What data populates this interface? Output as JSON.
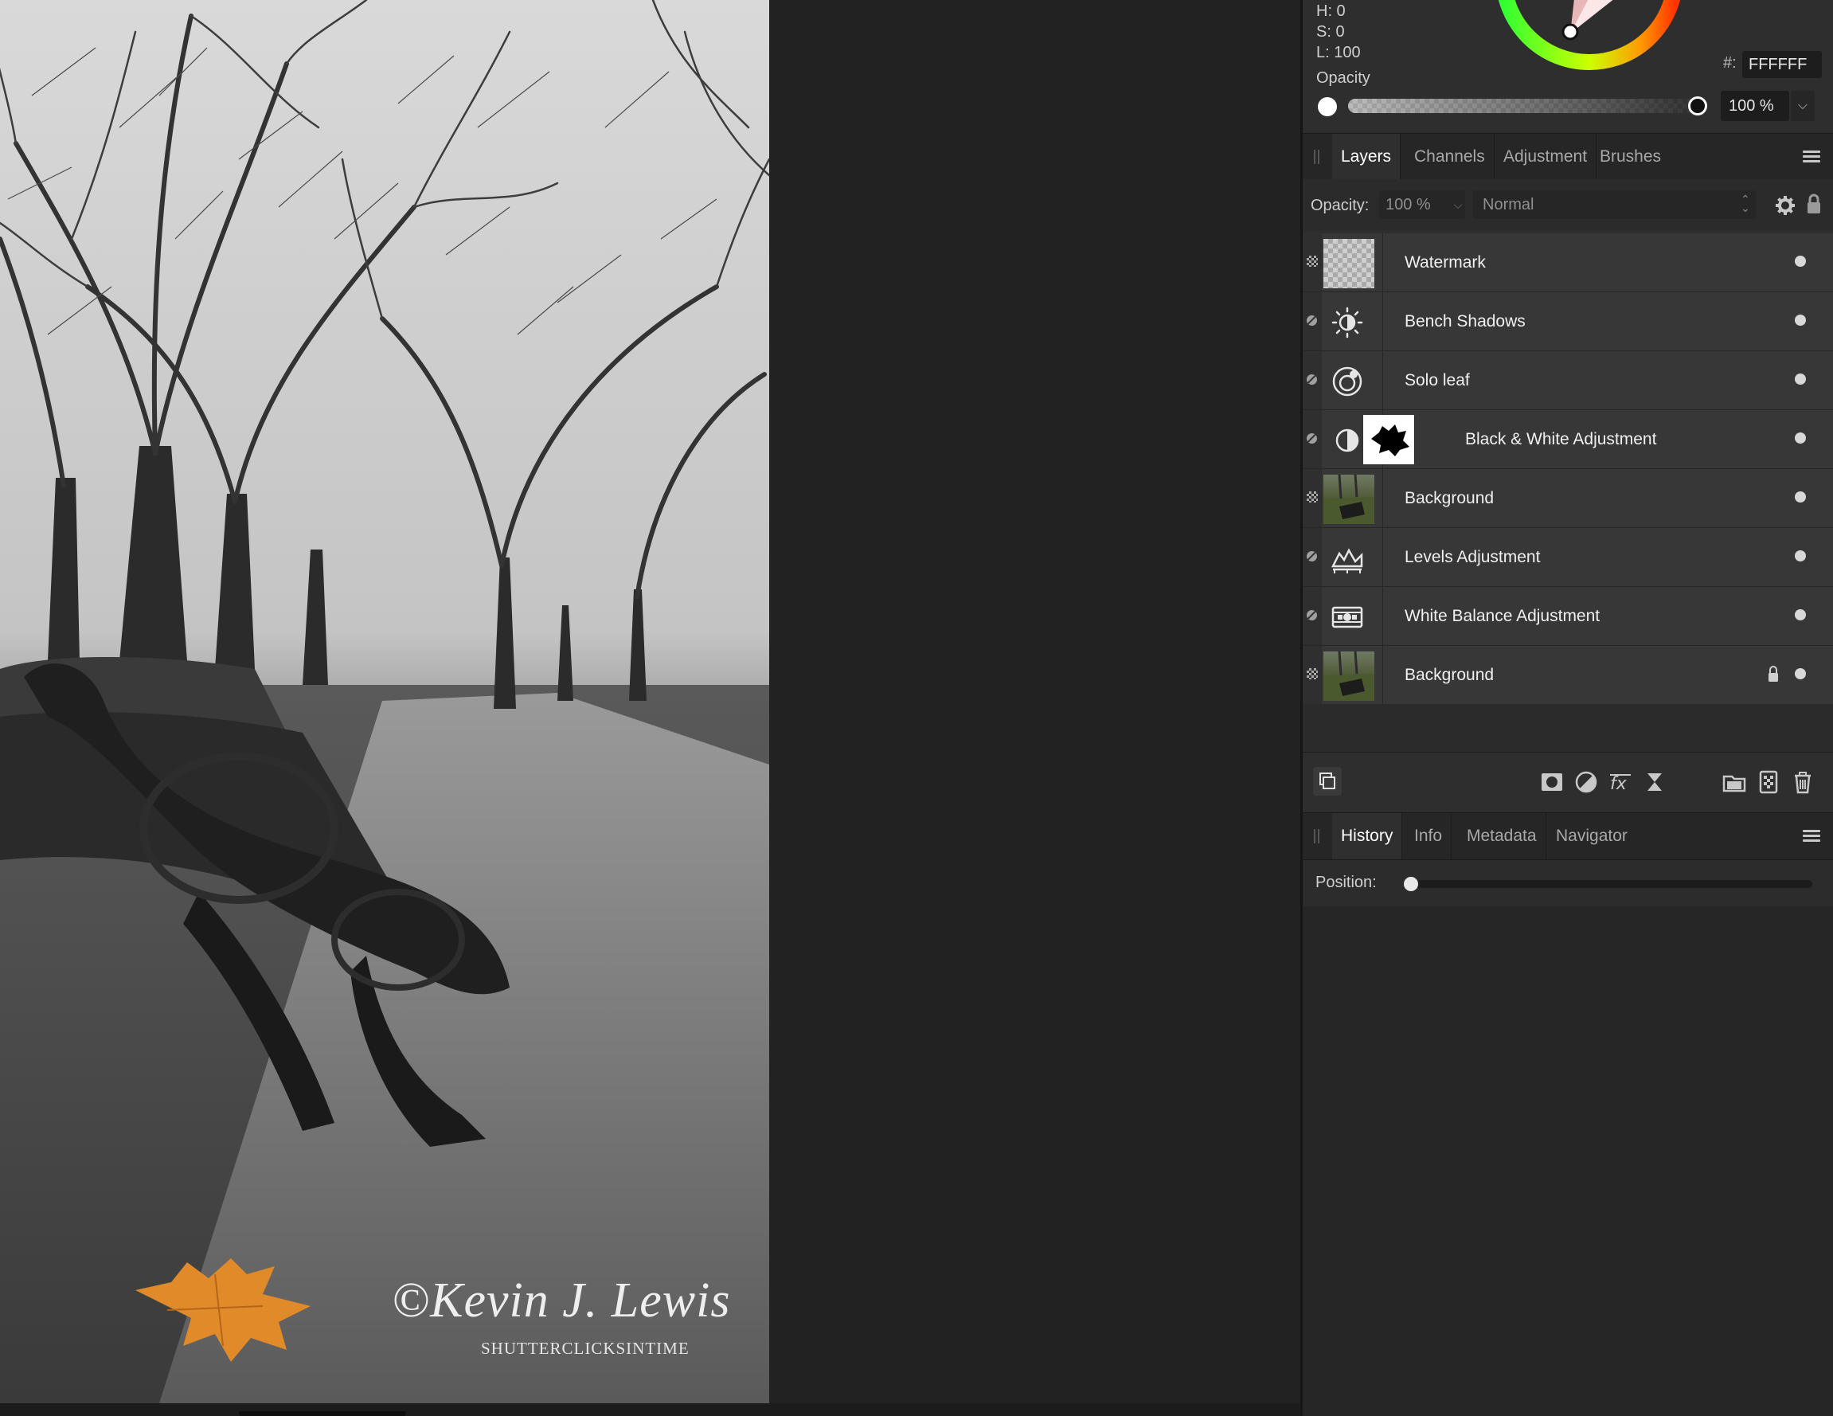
{
  "canvas": {
    "watermark_name": "©Kevin J. Lewis",
    "watermark_site": "SHUTTERCLICKSINTIME"
  },
  "color_panel": {
    "h_label": "H: 0",
    "s_label": "S: 0",
    "l_label": "L: 100",
    "hex_prefix": "#:",
    "hex_value": "FFFFFF",
    "opacity_label": "Opacity",
    "opacity_value": "100 %",
    "opacity_level": 1.0,
    "current_color": "#FFFFFF"
  },
  "layers_panel": {
    "tabs": [
      "Layers",
      "Channels",
      "Adjustment",
      "Brushes"
    ],
    "active_tab": "Layers",
    "opacity_label": "Opacity:",
    "opacity_value": "100 %",
    "blend_mode": "Normal",
    "layers": [
      {
        "name": "Watermark",
        "kind": "pixel",
        "icon": "checker-thumbnail",
        "locked": false,
        "visible": true
      },
      {
        "name": "Bench Shadows",
        "kind": "adjustment",
        "icon": "brightness-icon",
        "locked": false,
        "visible": true
      },
      {
        "name": "Solo leaf",
        "kind": "adjustment",
        "icon": "selective-color-icon",
        "locked": false,
        "visible": true
      },
      {
        "name": "Black & White Adjustment",
        "kind": "adjustment",
        "icon": "half-circle-icon",
        "has_mask": true,
        "locked": false,
        "visible": true
      },
      {
        "name": "Background",
        "kind": "pixel",
        "icon": "photo-thumbnail",
        "locked": false,
        "visible": true
      },
      {
        "name": "Levels Adjustment",
        "kind": "adjustment",
        "icon": "levels-icon",
        "locked": false,
        "visible": true
      },
      {
        "name": "White Balance Adjustment",
        "kind": "adjustment",
        "icon": "white-balance-icon",
        "locked": false,
        "visible": true
      },
      {
        "name": "Background",
        "kind": "pixel",
        "icon": "photo-thumbnail",
        "locked": true,
        "visible": true
      }
    ]
  },
  "history_panel": {
    "tabs": [
      "History",
      "Info",
      "Metadata",
      "Navigator"
    ],
    "active_tab": "History",
    "position_label": "Position:",
    "position_level": 0.0
  },
  "colors": {
    "panel_bg": "#2E2E2E",
    "canvas_bg": "#222222",
    "leaf_orange": "#E08A2A"
  }
}
